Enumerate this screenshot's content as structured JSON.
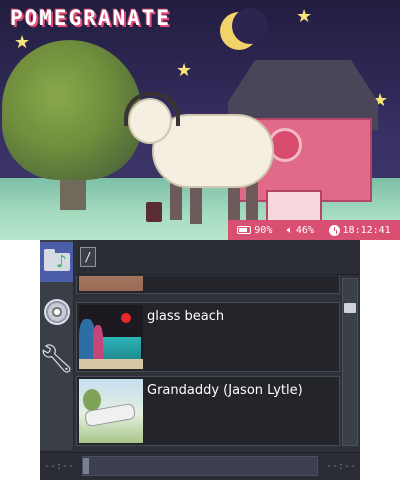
{
  "top_screen": {
    "logo_text": "POMEGRANATE",
    "status": {
      "battery": "90%",
      "volume": "46%",
      "time": "18:12:41",
      "icons": [
        "battery-icon",
        "speaker-icon",
        "clock-icon"
      ]
    },
    "colors": {
      "status_bar": "#d94f72",
      "sky": "#2e2855",
      "barn": "#e16a88"
    }
  },
  "bottom_screen": {
    "sidebar": {
      "items": [
        {
          "name": "music-folder",
          "icon": "folder-music-icon",
          "selected": true
        },
        {
          "name": "now-playing",
          "icon": "disc-icon",
          "selected": false
        },
        {
          "name": "settings",
          "icon": "wrench-icon",
          "selected": false
        }
      ]
    },
    "path": "/",
    "list": [
      {
        "title": "",
        "thumb_icon": "album-art-partial"
      },
      {
        "title": "glass beach",
        "thumb_icon": "album-art-glass-beach"
      },
      {
        "title": "Grandaddy (Jason Lytle)",
        "thumb_icon": "album-art-grandaddy"
      }
    ],
    "playback": {
      "elapsed": "--:--",
      "duration": "--:--",
      "progress": 0
    },
    "colors": {
      "selected_sidebar": "#4d5ea8",
      "background": "#2e3138"
    }
  }
}
